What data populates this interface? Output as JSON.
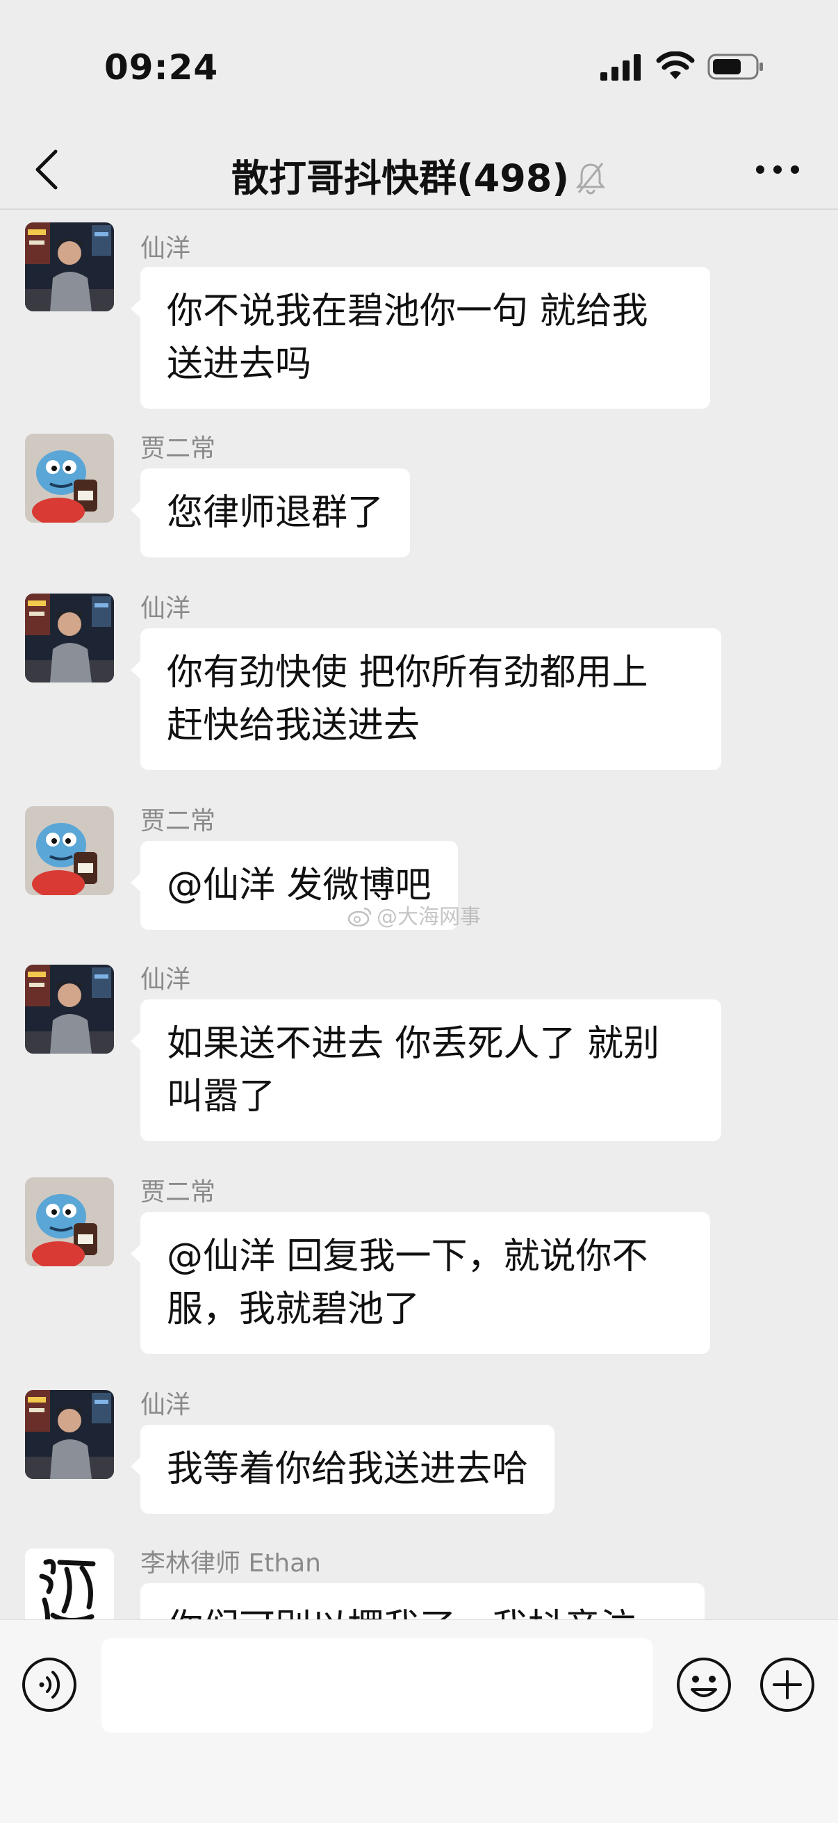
{
  "status_bar": {
    "time": "09:24"
  },
  "header": {
    "title": "散打哥抖快群(498)"
  },
  "messages": [
    {
      "sender": "仙洋",
      "avatar": "person-night-street",
      "text": "你不说我在碧池你一句 就给我送进去吗"
    },
    {
      "sender": "贾二常",
      "avatar": "blue-cartoon-mascot",
      "text": "您律师退群了"
    },
    {
      "sender": "仙洋",
      "avatar": "person-night-street",
      "text": "你有劲快使 把你所有劲都用上 赶快给我送进去"
    },
    {
      "sender": "贾二常",
      "avatar": "blue-cartoon-mascot",
      "text": "@仙洋 发微博吧"
    },
    {
      "sender": "仙洋",
      "avatar": "person-night-street",
      "text": "如果送不进去 你丢死人了 就别叫嚣了"
    },
    {
      "sender": "贾二常",
      "avatar": "blue-cartoon-mascot",
      "text": "@仙洋 回复我一下，就说你不服，我就碧池了"
    },
    {
      "sender": "仙洋",
      "avatar": "person-night-street",
      "text": "我等着你给我送进去哈"
    },
    {
      "sender": "李林律师 Ethan",
      "avatar": "calligraphy-logo",
      "text": "你们可别以摆我了，我抖音泣"
    }
  ],
  "input_bar": {
    "value": ""
  },
  "watermark": {
    "text": "@大海网事"
  },
  "colors": {
    "background": "#ededed",
    "bubble": "#ffffff",
    "sender": "#8a8a8a"
  }
}
